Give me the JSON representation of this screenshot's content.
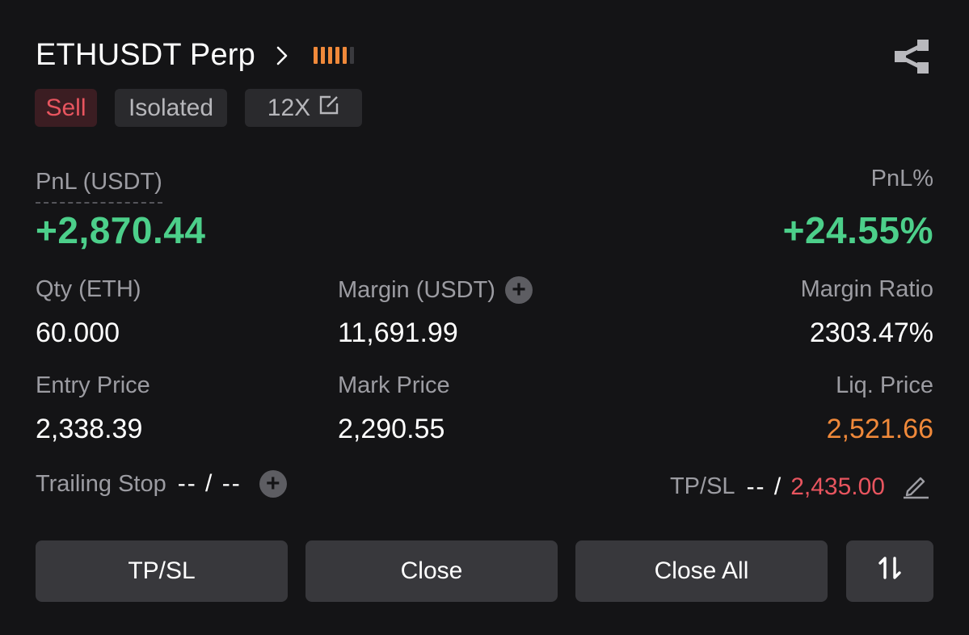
{
  "header": {
    "title": "ETHUSDT Perp",
    "chevron_icon": "chevron-right-icon",
    "risk_level": 5,
    "risk_max": 6,
    "risk_color": "#f0893a",
    "share_icon": "share-icon"
  },
  "tags": {
    "side": "Sell",
    "margin_mode": "Isolated",
    "leverage": "12X",
    "edit_icon": "edit-icon"
  },
  "pnl": {
    "label": "PnL (USDT)",
    "value": "+2,870.44",
    "percent_label": "PnL%",
    "percent_value": "+24.55%"
  },
  "stats": {
    "qty_label": "Qty (ETH)",
    "qty_value": "60.000",
    "margin_label": "Margin (USDT)",
    "margin_value": "11,691.99",
    "margin_ratio_label": "Margin Ratio",
    "margin_ratio_value": "2303.47%",
    "entry_label": "Entry Price",
    "entry_value": "2,338.39",
    "mark_label": "Mark Price",
    "mark_value": "2,290.55",
    "liq_label": "Liq. Price",
    "liq_value": "2,521.66"
  },
  "trailing": {
    "label": "Trailing Stop",
    "value": "-- / --"
  },
  "tpsl": {
    "label": "TP/SL",
    "tp_value": "-- /",
    "sl_value": "2,435.00"
  },
  "buttons": {
    "tpsl": "TP/SL",
    "close": "Close",
    "close_all": "Close All",
    "reverse_icon": "swap-vertical-icon"
  },
  "colors": {
    "background": "#141416",
    "profit": "#4ccf8a",
    "loss": "#e8555f",
    "liq": "#f0893a"
  }
}
